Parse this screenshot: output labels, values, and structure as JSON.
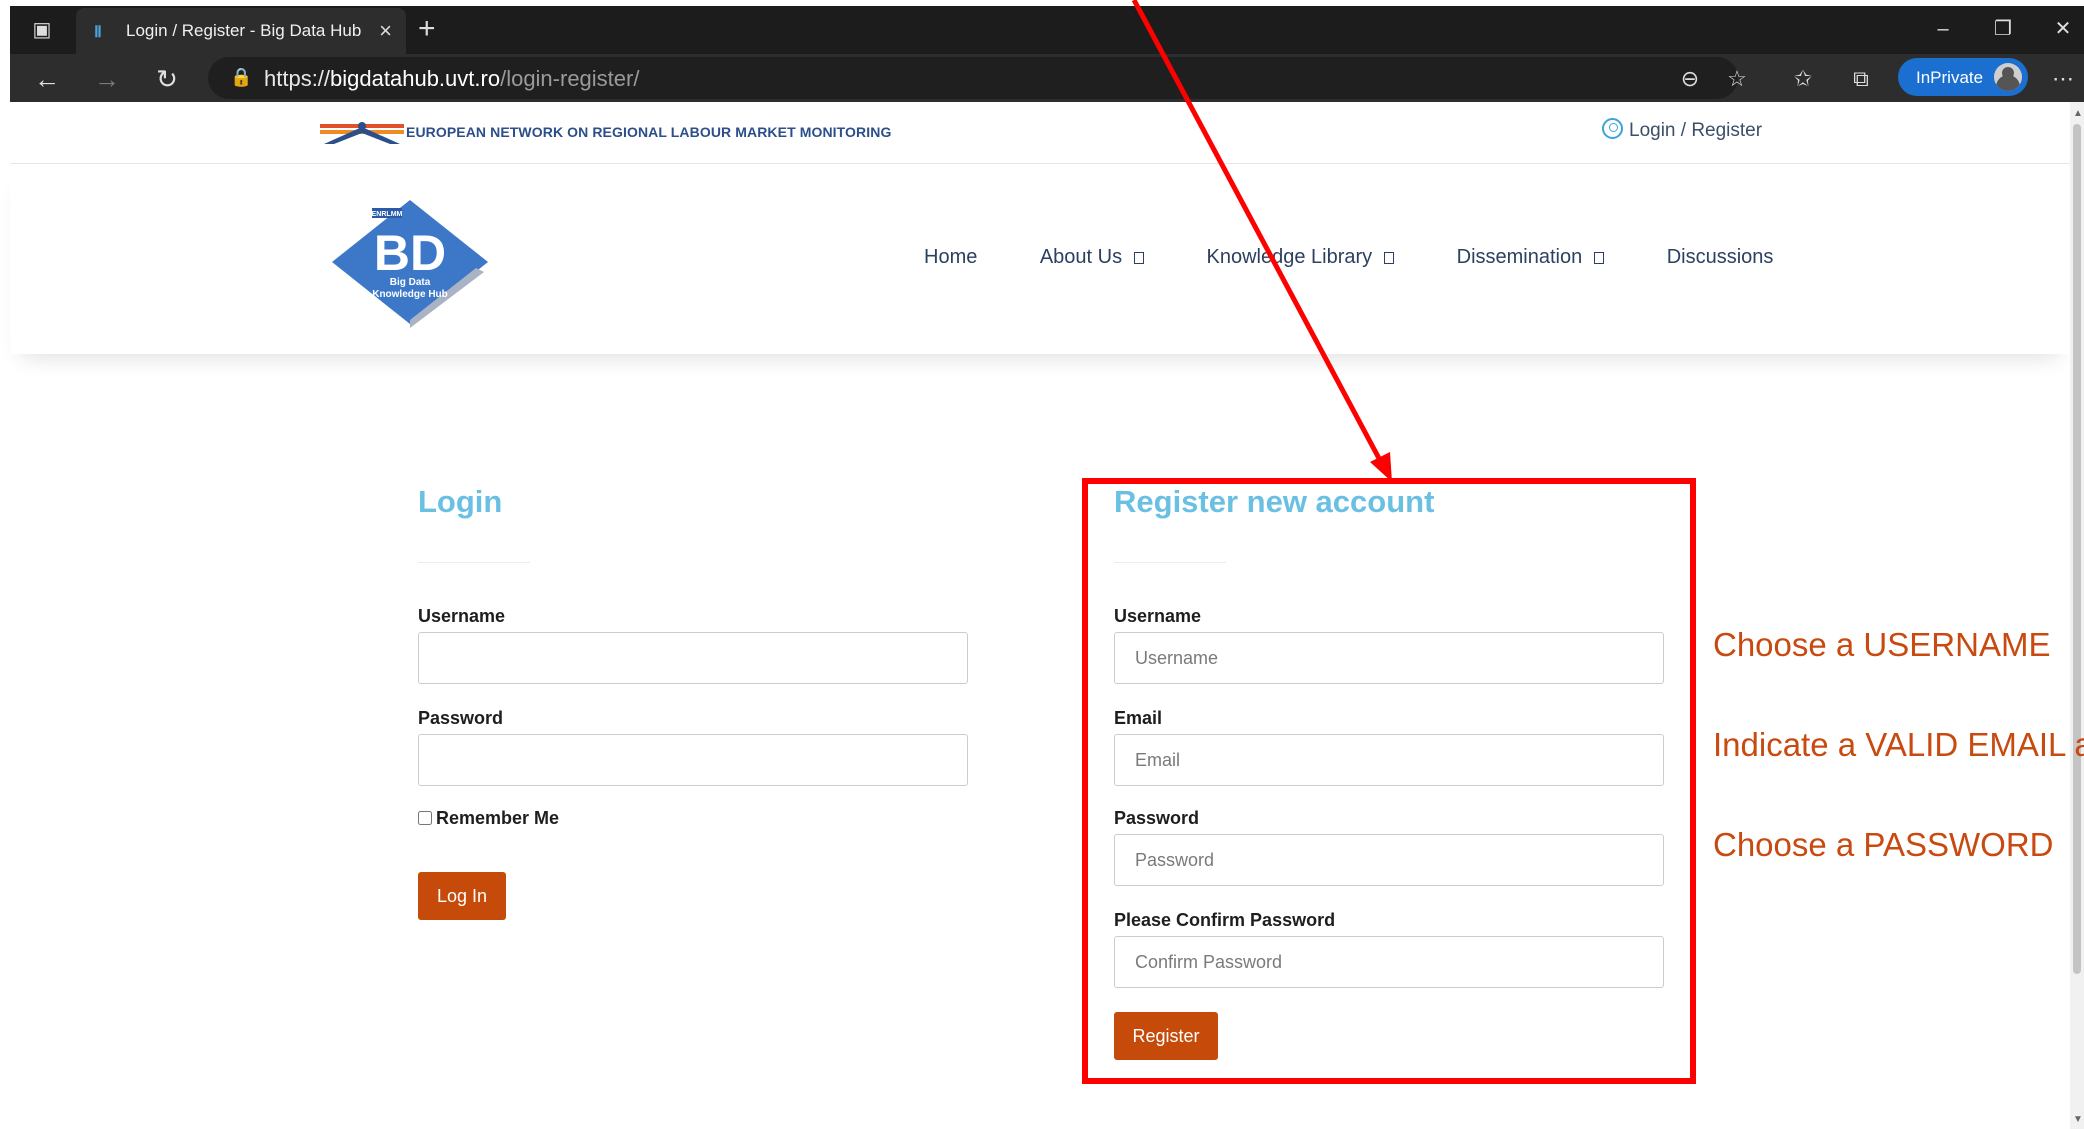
{
  "browser": {
    "tab_title": "Login / Register - Big Data Hub",
    "url_scheme": "https://",
    "url_host": "bigdatahub.uvt.ro",
    "url_path": "/login-register/",
    "inprivate_label": "InPrivate"
  },
  "topbar": {
    "network_name": "EUROPEAN NETWORK ON REGIONAL LABOUR MARKET MONITORING",
    "login_link": "Login / Register"
  },
  "logo": {
    "small_text": "ENRLMM",
    "letters": "BD",
    "line1": "Big Data",
    "line2": "Knowledge Hub"
  },
  "nav": {
    "items": [
      {
        "label": "Home",
        "dropdown": false
      },
      {
        "label": "About Us",
        "dropdown": true
      },
      {
        "label": "Knowledge Library",
        "dropdown": true
      },
      {
        "label": "Dissemination",
        "dropdown": true
      },
      {
        "label": "Discussions",
        "dropdown": false
      }
    ]
  },
  "login": {
    "title": "Login",
    "username_label": "Username",
    "password_label": "Password",
    "remember_label": "Remember Me",
    "submit_label": "Log In"
  },
  "register": {
    "title": "Register new account",
    "username_label": "Username",
    "username_placeholder": "Username",
    "email_label": "Email",
    "email_placeholder": "Email",
    "password_label": "Password",
    "password_placeholder": "Password",
    "confirm_label": "Please Confirm Password",
    "confirm_placeholder": "Confirm Password",
    "submit_label": "Register"
  },
  "annotations": {
    "note_username": "Choose a USERNAME",
    "note_email": "Indicate a VALID EMAIL a",
    "note_password": "Choose a PASSWORD"
  },
  "colors": {
    "accent_title": "#6ac0e3",
    "button": "#c64a0a",
    "annotation_red": "#ff0000",
    "annotation_text": "#c84a10",
    "nav_text": "#2c4060"
  }
}
